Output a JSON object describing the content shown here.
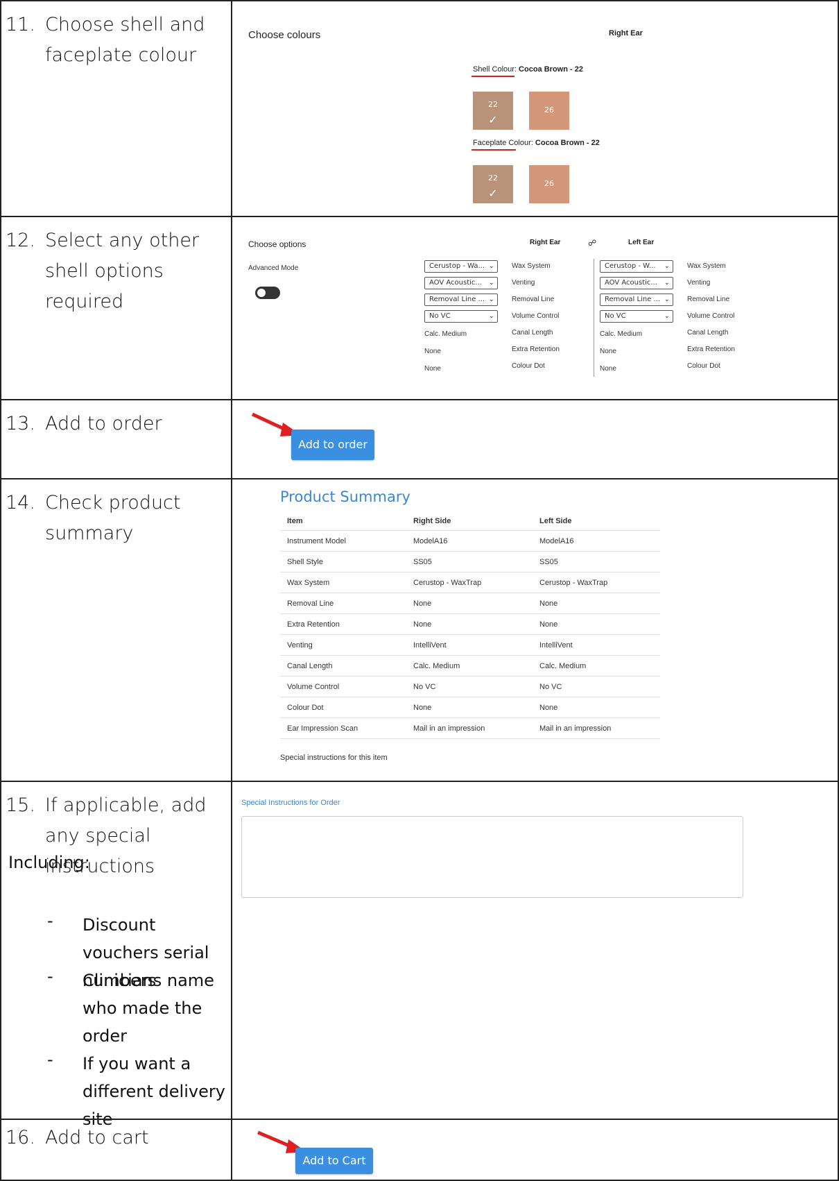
{
  "steps": [
    {
      "num": "11.",
      "text": "Choose shell and faceplate colour"
    },
    {
      "num": "12.",
      "text": "Select any other shell options required"
    },
    {
      "num": "13.",
      "text": "Add to order"
    },
    {
      "num": "14.",
      "text": "Check product summary"
    },
    {
      "num": "15.",
      "text": "If applicable, add any special instructions"
    },
    {
      "num": "16.",
      "text": "Add to cart"
    }
  ],
  "step15": {
    "including": "Including:",
    "bullets": [
      "Discount vouchers serial numbers",
      "Clinicians name who made the order",
      "If you want a different delivery site"
    ]
  },
  "colours": {
    "heading": "Choose colours",
    "ear": "Right Ear",
    "shell_label": "Shell Colour",
    "shell_value": "Cocoa Brown - 22",
    "faceplate_label": "Faceplate Colour",
    "faceplate_value": "Cocoa Brown - 22",
    "swatches": [
      {
        "code": "22",
        "color": "#b8937a",
        "selected": true
      },
      {
        "code": "26",
        "color": "#d4977a",
        "selected": false
      }
    ],
    "check_glyph": "✓",
    "underline_color": "#cc2222"
  },
  "options": {
    "heading": "Choose options",
    "right_ear": "Right Ear",
    "left_ear": "Left Ear",
    "link_icon": "link-icon",
    "advanced_mode": "Advanced Mode",
    "right": {
      "selects": [
        "Cerustop - Wa...",
        "AOV Acoustic...",
        "Removal Line ...",
        "No VC"
      ],
      "static": [
        "Calc. Medium",
        "None",
        "None"
      ]
    },
    "left": {
      "selects": [
        "Cerustop - W...",
        "AOV Acoustic...",
        "Removal Line ...",
        "No VC"
      ],
      "static": [
        "Calc. Medium",
        "None",
        "None"
      ]
    },
    "labels": [
      "Wax System",
      "Venting",
      "Removal Line",
      "Volume Control",
      "Canal Length",
      "Extra Retention",
      "Colour Dot"
    ]
  },
  "add_to_order": {
    "label": "Add to order"
  },
  "summary": {
    "title": "Product Summary",
    "headers": [
      "Item",
      "Right Side",
      "Left Side"
    ],
    "rows": [
      [
        "Instrument Model",
        "ModelA16",
        "ModelA16"
      ],
      [
        "Shell Style",
        "SS05",
        "SS05"
      ],
      [
        "Wax System",
        "Cerustop - WaxTrap",
        "Cerustop - WaxTrap"
      ],
      [
        "Removal Line",
        "None",
        "None"
      ],
      [
        "Extra Retention",
        "None",
        "None"
      ],
      [
        "Venting",
        "IntelliVent",
        "IntelliVent"
      ],
      [
        "Canal Length",
        "Calc. Medium",
        "Calc. Medium"
      ],
      [
        "Volume Control",
        "No VC",
        "No VC"
      ],
      [
        "Colour Dot",
        "None",
        "None"
      ],
      [
        "Ear Impression Scan",
        "Mail in an impression",
        "Mail in an impression"
      ]
    ],
    "special_item": "Special instructions for this item"
  },
  "special_order": {
    "label": "Special Instructions for Order",
    "value": ""
  },
  "add_to_cart": {
    "label": "Add to Cart"
  },
  "accent": "#3b8fe0",
  "arrow_color": "#e02020"
}
